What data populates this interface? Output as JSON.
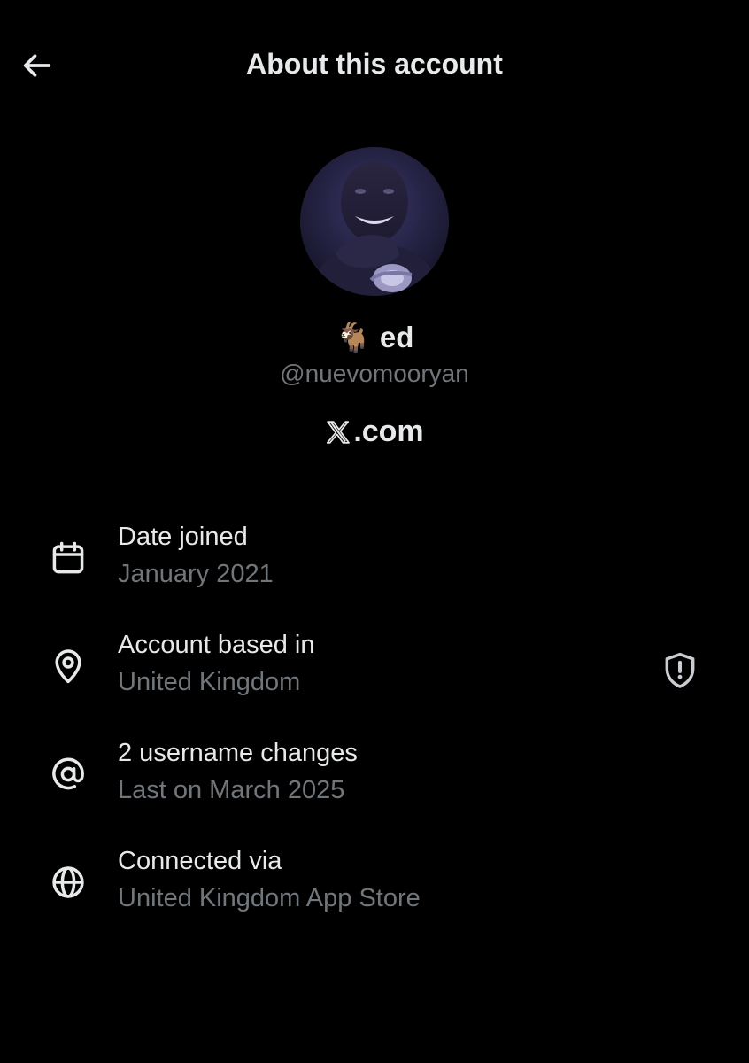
{
  "header": {
    "title": "About this account"
  },
  "profile": {
    "emoji": "🐐",
    "display_name_text": "ed",
    "username": "@nuevomooryan",
    "brand_suffix": ".com"
  },
  "details": [
    {
      "icon": "calendar-icon",
      "label": "Date joined",
      "value": "January 2021"
    },
    {
      "icon": "location-pin-icon",
      "label": "Account based in",
      "value": "United Kingdom"
    },
    {
      "icon": "at-sign-icon",
      "label": "2 username changes",
      "value": "Last on March 2025"
    },
    {
      "icon": "globe-icon",
      "label": "Connected via",
      "value": "United Kingdom App Store"
    }
  ],
  "colors": {
    "background": "#000000",
    "primary_text": "#e7e9ea",
    "secondary_text": "#71767b"
  }
}
